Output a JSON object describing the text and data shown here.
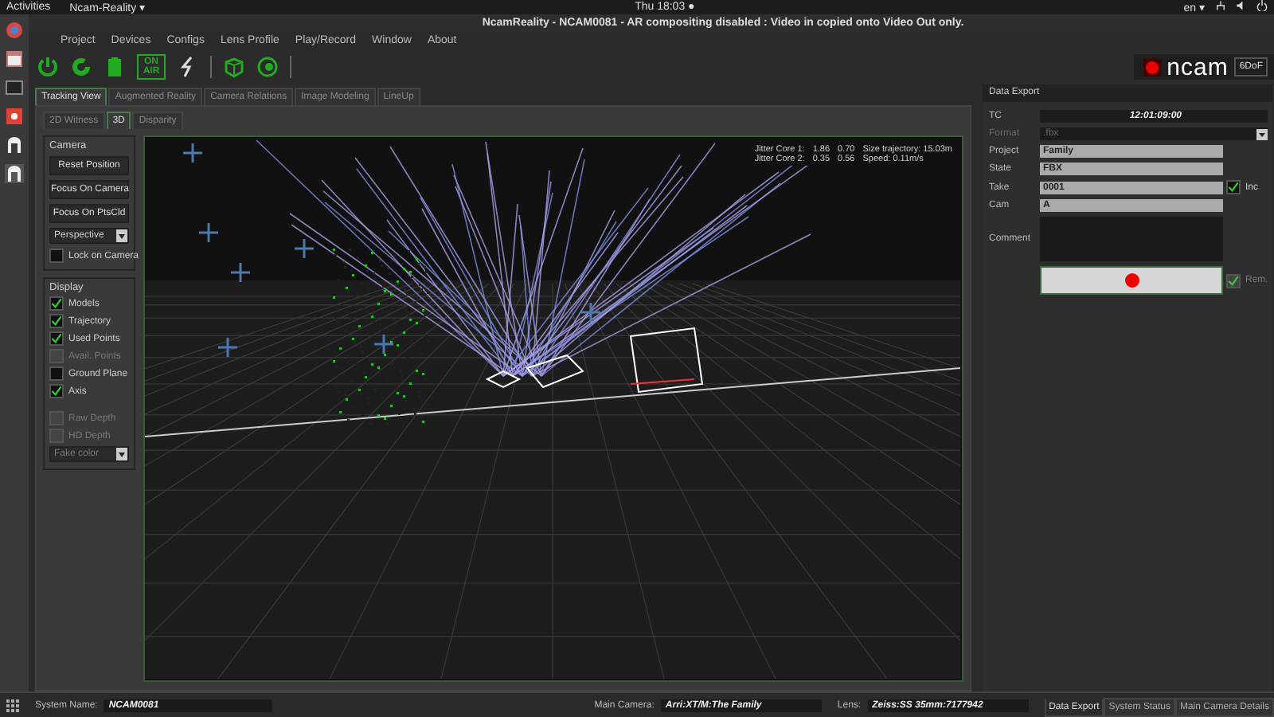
{
  "top_bar": {
    "activities": "Activities",
    "app_menu": "Ncam-Reality ▾",
    "clock": "Thu 18:03 ●",
    "keyboard": "en ▾"
  },
  "window": {
    "title": "NcamReality - NCAM0081  - AR compositing disabled : Video in copied onto Video Out only."
  },
  "menu": [
    "Project",
    "Devices",
    "Configs",
    "Lens Profile",
    "Play/Record",
    "Window",
    "About"
  ],
  "toolbar": {
    "on_air_label": "ON AIR",
    "logo": "ncam",
    "mode": "6DoF"
  },
  "main_tabs": [
    {
      "label": "Tracking View",
      "selected": true
    },
    {
      "label": "Augmented Reality",
      "selected": false
    },
    {
      "label": "Camera Relations",
      "selected": false
    },
    {
      "label": "Image Modeling",
      "selected": false
    },
    {
      "label": "LineUp",
      "selected": false
    }
  ],
  "view_tabs": [
    {
      "label": "2D Witness",
      "selected": false
    },
    {
      "label": "3D",
      "selected": true
    },
    {
      "label": "Disparity",
      "selected": false
    }
  ],
  "camera_panel": {
    "title": "Camera",
    "buttons": [
      "Reset Position",
      "Focus On Camera",
      "Focus On PtsCld"
    ],
    "projection": "Perspective",
    "lock": {
      "label": "Lock on Camera",
      "checked": false
    }
  },
  "display_panel": {
    "title": "Display",
    "options": [
      {
        "label": "Models",
        "checked": true,
        "disabled": false
      },
      {
        "label": "Trajectory",
        "checked": true,
        "disabled": false
      },
      {
        "label": "Used Points",
        "checked": true,
        "disabled": false
      },
      {
        "label": "Avail. Points",
        "checked": false,
        "disabled": true
      },
      {
        "label": "Ground Plane",
        "checked": false,
        "disabled": false
      },
      {
        "label": "Axis",
        "checked": true,
        "disabled": false
      },
      {
        "label": "Raw Depth",
        "checked": false,
        "disabled": true
      },
      {
        "label": "HD Depth",
        "checked": false,
        "disabled": true
      }
    ],
    "color_mode": "Fake color"
  },
  "stats": [
    {
      "label": "Jitter Core 1:",
      "value_1": "1.86",
      "value_2": "0.70",
      "extra": "Size trajectory: 15.03m"
    },
    {
      "label": "Jitter Core 2:",
      "value_1": "0.35",
      "value_2": "0.56",
      "extra": "Speed: 0.11m/s"
    }
  ],
  "data_export": {
    "title": "Data Export",
    "fields": [
      {
        "label": "TC",
        "value": "12:01:09:00",
        "kind": "display"
      },
      {
        "label": "Format",
        "value": ".fbx",
        "kind": "dropdown"
      },
      {
        "label": "Project",
        "value": "Family",
        "kind": "text"
      },
      {
        "label": "State",
        "value": "FBX",
        "kind": "text"
      },
      {
        "label": "Take",
        "value": "0001",
        "kind": "text",
        "option": {
          "label": "Inc",
          "checked": true
        }
      },
      {
        "label": "Cam",
        "value": "A",
        "kind": "text"
      },
      {
        "label": "Comment",
        "kind": "textarea"
      }
    ],
    "record": {
      "option": {
        "label": "Rem.",
        "checked": true
      }
    }
  },
  "status_bar": {
    "fields": [
      {
        "label": "System Name:",
        "value": "NCAM0081"
      },
      {
        "label": "Main Camera:",
        "value": "Arri:XT/M:The Family"
      },
      {
        "label": "Lens:",
        "value": "Zeiss:SS 35mm:7177942"
      }
    ],
    "dock_tabs": [
      {
        "label": "Data Export",
        "selected": true
      },
      {
        "label": "System Status",
        "selected": false
      },
      {
        "label": "Main Camera Details",
        "selected": false
      }
    ]
  }
}
